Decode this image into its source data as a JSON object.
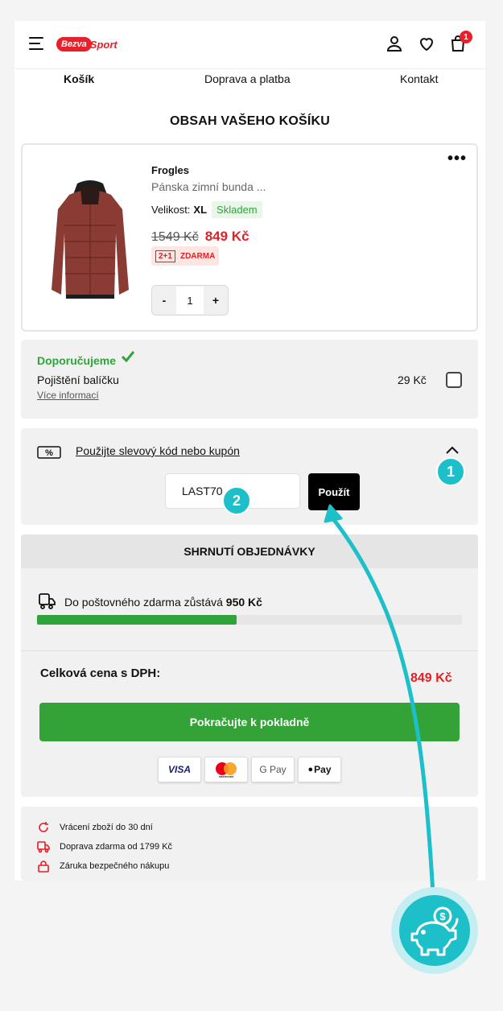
{
  "header": {
    "logo_left": "Bezva",
    "logo_right": "Sport",
    "cart_count": "1",
    "icons": [
      "menu-icon",
      "user-icon",
      "heart-icon",
      "cart-icon"
    ]
  },
  "steps": [
    "Košík",
    "Doprava a platba",
    "Kontakt"
  ],
  "page_title": "OBSAH VAŠEHO KOŠÍKU",
  "product": {
    "brand": "Frogles",
    "name": "Pánska zimní bunda ...",
    "size_label": "Velikost:",
    "size_value": "XL",
    "stock": "Skladem",
    "old_price": "1549 Kč",
    "new_price": "849 Kč",
    "promo_tag": "2+1",
    "promo_text": "ZDARMA",
    "qty_minus": "-",
    "qty_value": "1",
    "qty_plus": "+",
    "more": "•••"
  },
  "recommend": {
    "title": "Doporučujeme",
    "label": "Pojištění balíčku",
    "more": "Více informací",
    "price": "29 Kč"
  },
  "coupon": {
    "icon_text": "[%]",
    "link": "Použijte slevový kód nebo kupón",
    "code_value": "LAST70",
    "apply": "Použít"
  },
  "summary": {
    "title": "SHRNUTÍ OBJEDNÁVKY",
    "shipping_text": "Do poštovného zdarma zůstává",
    "shipping_amount": "950 Kč",
    "progress": 0.47,
    "total_label": "Celková cena s DPH:",
    "total_price": "849 Kč",
    "checkout": "Pokračujte k pokladně",
    "payments": [
      "VISA",
      "mastercard",
      "G Pay",
      "Pay"
    ]
  },
  "benefits": [
    "Vrácení zboží do 30 dní",
    "Doprava zdarma od 1799 Kč",
    "Záruka bezpečného nákupu"
  ],
  "annotations": [
    "1",
    "2"
  ],
  "colors": {
    "brand_red": "#e8202a",
    "price_red": "#e21f26",
    "green": "#33a337",
    "teal": "#1dbfc9"
  }
}
